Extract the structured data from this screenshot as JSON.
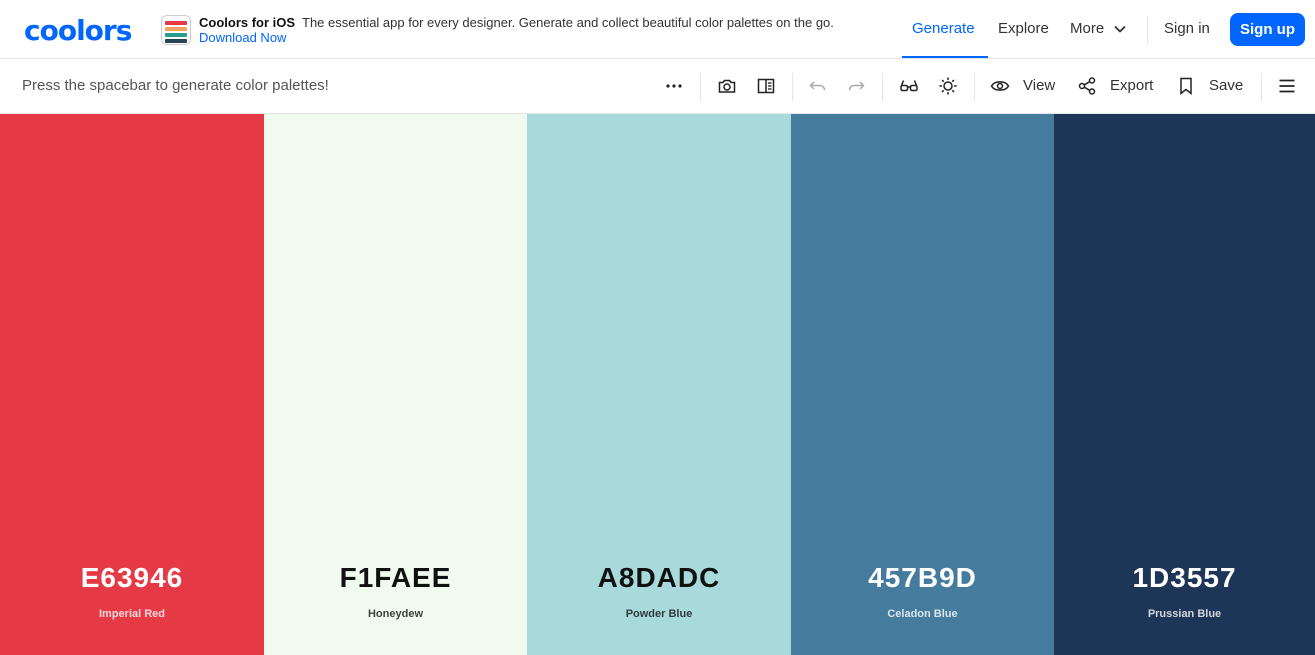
{
  "brand": {
    "logo": "coolors"
  },
  "promo": {
    "title": "Coolors for iOS",
    "description": "The essential app for every designer. Generate and collect beautiful color palettes on the go.",
    "link": "Download Now"
  },
  "nav": {
    "generate": "Generate",
    "explore": "Explore",
    "more": "More",
    "sign_in": "Sign in",
    "sign_up": "Sign up"
  },
  "toolbar": {
    "hint": "Press the spacebar to generate color palettes!",
    "view": "View",
    "export": "Export",
    "save": "Save",
    "icons": [
      "more-dots-icon",
      "camera-icon",
      "layout-icon",
      "undo-icon",
      "redo-icon",
      "glasses-icon",
      "brightness-icon",
      "eye-icon",
      "share-icon",
      "bookmark-icon",
      "hamburger-icon"
    ]
  },
  "accent_color": "#0066ff",
  "palette": [
    {
      "hex": "E63946",
      "name": "Imperial Red",
      "color": "#E63946",
      "text_color": "#ffffff"
    },
    {
      "hex": "F1FAEE",
      "name": "Honeydew",
      "color": "#F1FAEE",
      "text_color": "#111111"
    },
    {
      "hex": "A8DADC",
      "name": "Powder Blue",
      "color": "#A8DADC",
      "text_color": "#111111"
    },
    {
      "hex": "457B9D",
      "name": "Celadon Blue",
      "color": "#457B9D",
      "text_color": "#ffffff"
    },
    {
      "hex": "1D3557",
      "name": "Prussian Blue",
      "color": "#1D3557",
      "text_color": "#ffffff"
    }
  ]
}
